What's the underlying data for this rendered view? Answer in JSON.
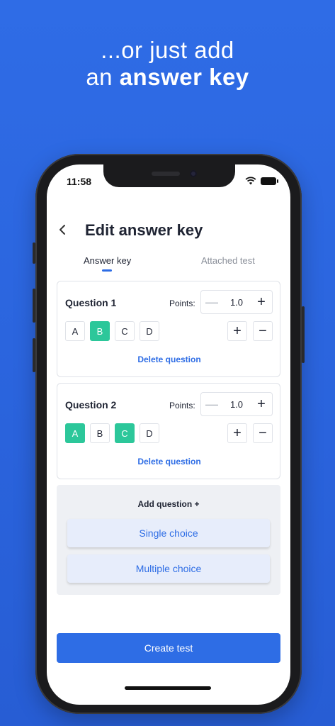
{
  "headline": {
    "line1": "...or just add",
    "line2_prefix": "an ",
    "line2_bold": "answer key"
  },
  "status": {
    "time": "11:58"
  },
  "header": {
    "back_icon": "chevron-left-icon",
    "title": "Edit answer key"
  },
  "tabs": [
    {
      "label": "Answer key",
      "active": true
    },
    {
      "label": "Attached test",
      "active": false
    }
  ],
  "questions": [
    {
      "title": "Question 1",
      "points_label": "Points:",
      "points": "1.0",
      "options": [
        {
          "label": "A",
          "selected": false
        },
        {
          "label": "B",
          "selected": true
        },
        {
          "label": "C",
          "selected": false
        },
        {
          "label": "D",
          "selected": false
        }
      ],
      "delete_label": "Delete question"
    },
    {
      "title": "Question 2",
      "points_label": "Points:",
      "points": "1.0",
      "options": [
        {
          "label": "A",
          "selected": true
        },
        {
          "label": "B",
          "selected": false
        },
        {
          "label": "C",
          "selected": true
        },
        {
          "label": "D",
          "selected": false
        }
      ],
      "delete_label": "Delete question"
    }
  ],
  "add": {
    "title": "Add question +",
    "single_choice": "Single choice",
    "multiple_choice": "Multiple choice"
  },
  "create_button": "Create test",
  "colors": {
    "accent": "#2e6de5",
    "selected": "#2cc79a",
    "background": "#2a63dc"
  }
}
